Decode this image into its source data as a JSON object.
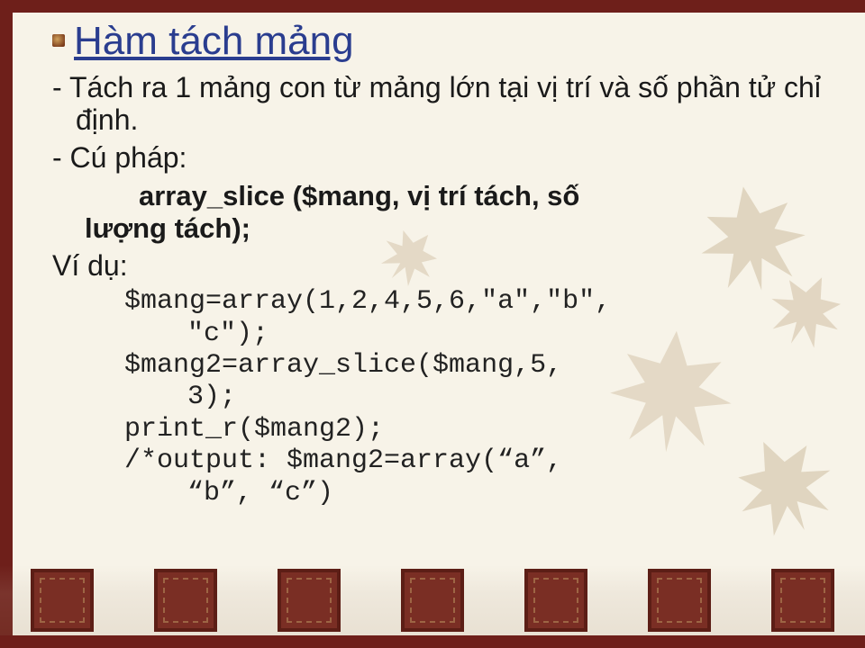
{
  "title": "Hàm tách mảng",
  "desc1": "Tách ra 1 mảng con từ mảng lớn tại vị trí và số phần tử chỉ định.",
  "syntax_label": "Cú pháp:",
  "syntax_l1": "array_slice ($mang, vị trí tách, số",
  "syntax_l2": "lượng tách);",
  "example_label": "Ví dụ:",
  "code": {
    "l1": "$mang=array(1,2,4,5,6,\"a\",\"b\",",
    "l1c": "\"c\");",
    "l2": "$mang2=array_slice($mang,5,",
    "l2c": "3);",
    "l3": "print_r($mang2);",
    "l4": "/*output: $mang2=array(“a”,",
    "l4c": "“b”, “c”)"
  }
}
